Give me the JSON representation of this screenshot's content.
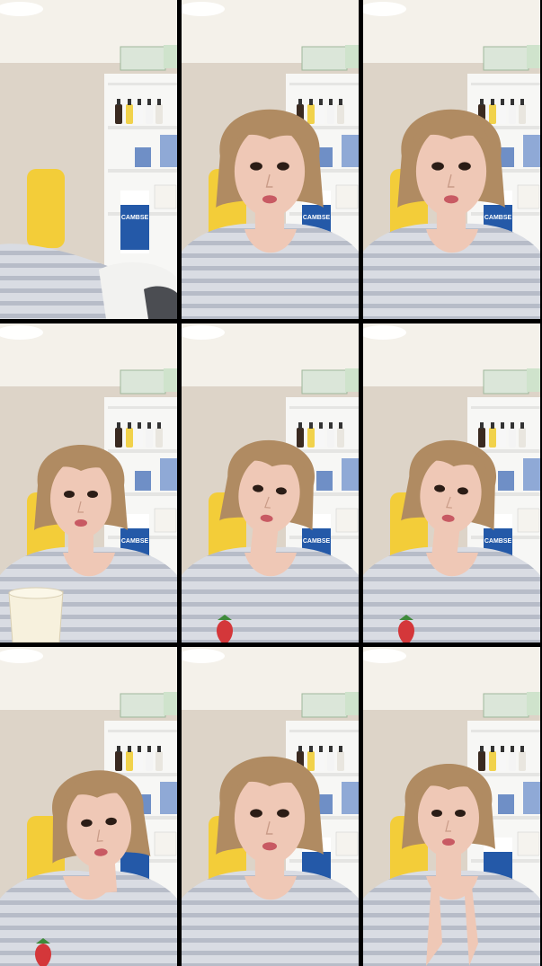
{
  "image": {
    "layout": "3x3 grid of video frames",
    "scene": "room with white shelves and a yellow chair",
    "frames": [
      {
        "id": "frame-1",
        "pose": "blurred-arm-foreground",
        "accent_top": "#f5f4ef",
        "packaging_text": "CAMBSE"
      },
      {
        "id": "frame-2",
        "pose": "face-center",
        "packaging_text": "CAMBSE"
      },
      {
        "id": "frame-3",
        "pose": "face-center",
        "packaging_text": "CAMBSE"
      },
      {
        "id": "frame-4",
        "pose": "holding-cup",
        "packaging_text": "CAMBSE"
      },
      {
        "id": "frame-5",
        "pose": "face-down",
        "packaging_text": "CAMBSE"
      },
      {
        "id": "frame-6",
        "pose": "face-down",
        "packaging_text": "CAMBSE"
      },
      {
        "id": "frame-7",
        "pose": "face-left",
        "packaging_text": ""
      },
      {
        "id": "frame-8",
        "pose": "face-center",
        "packaging_text": ""
      },
      {
        "id": "frame-9",
        "pose": "hands-up",
        "packaging_text": ""
      }
    ],
    "colors": {
      "wall": "#ddd4c8",
      "ceiling": "#f4f1ea",
      "shelf": "#f7f7f5",
      "chair": "#f3cd39",
      "shirt_base": "#d9dce3",
      "shirt_stripe": "#9aa3b2",
      "hair": "#b08b62",
      "skin": "#efc8b6",
      "strawberry": "#d4373a",
      "box_blue": "#2459a8"
    }
  }
}
